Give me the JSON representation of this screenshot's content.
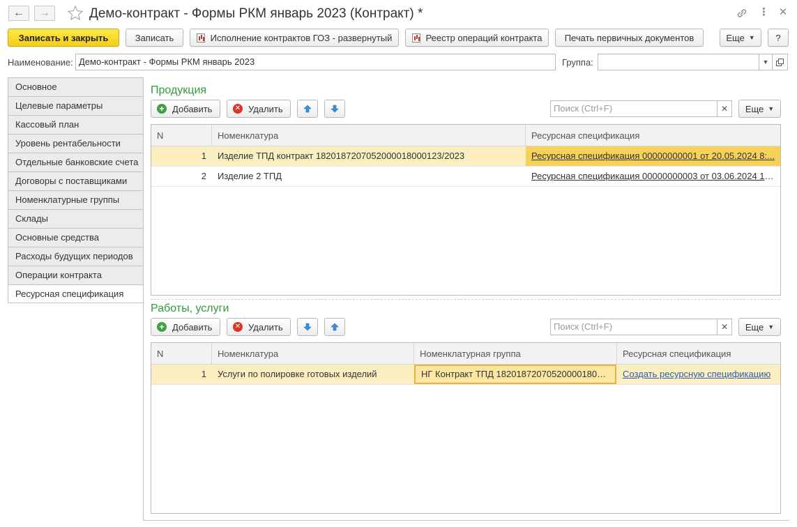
{
  "window": {
    "title": "Демо-контракт - Формы РКМ январь 2023 (Контракт) *"
  },
  "toolbar": {
    "save_close": "Записать и закрыть",
    "save": "Записать",
    "report1": "Исполнение контрактов ГОЗ - развернутый",
    "report2": "Реестр операций контракта",
    "print": "Печать первичных документов",
    "more": "Еще",
    "help": "?"
  },
  "form": {
    "name_label": "Наименование:",
    "name_value": "Демо-контракт - Формы РКМ январь 2023",
    "group_label": "Группа:",
    "group_value": ""
  },
  "tabs": [
    {
      "label": "Основное"
    },
    {
      "label": "Целевые параметры"
    },
    {
      "label": "Кассовый план"
    },
    {
      "label": "Уровень рентабельности"
    },
    {
      "label": "Отдельные банковские счета"
    },
    {
      "label": "Договоры с поставщиками"
    },
    {
      "label": "Номенклатурные группы"
    },
    {
      "label": "Склады"
    },
    {
      "label": "Основные средства"
    },
    {
      "label": "Расходы будущих периодов"
    },
    {
      "label": "Операции контракта"
    },
    {
      "label": "Ресурсная спецификация",
      "active": true
    }
  ],
  "products": {
    "title": "Продукция",
    "add": "Добавить",
    "delete": "Удалить",
    "search_placeholder": "Поиск (Ctrl+F)",
    "more": "Еще",
    "columns": [
      "N",
      "Номенклатура",
      "Ресурсная спецификация"
    ],
    "rows": [
      {
        "n": "1",
        "item": "Изделие ТПД контракт 1820187207052000018000123/2023",
        "spec": "Ресурсная спецификация 00000000001 от 20.05.2024 8:..."
      },
      {
        "n": "2",
        "item": "Изделие 2 ТПД",
        "spec": "Ресурсная спецификация 00000000003 от 03.06.2024 18..."
      }
    ]
  },
  "services": {
    "title": "Работы, услуги",
    "add": "Добавить",
    "delete": "Удалить",
    "search_placeholder": "Поиск (Ctrl+F)",
    "more": "Еще",
    "columns": [
      "N",
      "Номенклатура",
      "Номенклатурная группа",
      "Ресурсная спецификация"
    ],
    "rows": [
      {
        "n": "1",
        "item": "Услуги по полировке готовых изделий",
        "group": "НГ Контракт ТПД 1820187207052000018000...",
        "spec": "Создать ресурсную спецификацию"
      }
    ]
  },
  "colors": {
    "accent_green": "#2f9c3a",
    "primary_button": "#f4cf14",
    "selected_row": "#fbeec1",
    "current_cell": "#f7d25a",
    "link_blue": "#2a5db0"
  }
}
